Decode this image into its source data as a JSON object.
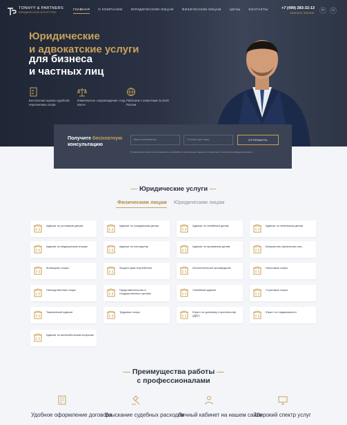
{
  "header": {
    "brand_name": "TONHYY & PARTNERS",
    "brand_tagline": "ЮРИДИЧЕСКОЕ АГЕНТСТВО",
    "nav": [
      "ГЛАВНАЯ",
      "О КОМПАНИИ",
      "ЮРИДИЧЕСКИМ ЛИЦАМ",
      "ФИЗИЧЕСКИМ ЛИЦАМ",
      "ЦЕНЫ",
      "КОНТАКТЫ"
    ],
    "phone": "+7 (499) 283-32-13",
    "callback": "ЗАКАЗАТЬ ЗВОНОК"
  },
  "hero": {
    "title_line1": "Юридические",
    "title_line2": "и адвокатские услуги",
    "title_line3": "для бизнеса",
    "title_line4": "и частных лиц",
    "features": [
      {
        "icon": "checklist-icon",
        "text": "Бесплатная оценка судебной перспективы спора"
      },
      {
        "icon": "scales-icon",
        "text": "Комплексное сопровождение «под ключ»"
      },
      {
        "icon": "globe-icon",
        "text": "Работаем с клиентами по всей России"
      }
    ]
  },
  "consult": {
    "title_a": "Получите",
    "title_b": "бесплатную",
    "title_c": "консультацию",
    "name_placeholder": "Ваше имя/фамилия",
    "phone_placeholder": "Телефон для связи",
    "submit": "ОТПРАВИТЬ",
    "note": "Оставляя ваш вопрос, вы соглашаетесь на обработку персональных данных в соответствии с политикой конфиденциальности"
  },
  "services": {
    "title": "Юридические услуги",
    "tab_active": "Физическим лицам",
    "tab_other": "Юридическим лицам",
    "items": [
      {
        "icon": "building-icon",
        "label": "Адвокат по уголовным делам"
      },
      {
        "icon": "family-icon",
        "label": "Адвокат по гражданским делам"
      },
      {
        "icon": "person-icon",
        "label": "Адвокат по семейным делам"
      },
      {
        "icon": "house-icon",
        "label": "Адвокат по земельным делам"
      },
      {
        "icon": "heart-icon",
        "label": "Адвокат по медицинским спорам"
      },
      {
        "icon": "person-icon",
        "label": "Адвокат по наследству"
      },
      {
        "icon": "worker-icon",
        "label": "Адвокат по призывным делам"
      },
      {
        "icon": "bank-icon",
        "label": "Банкротство физических лиц"
      },
      {
        "icon": "houses-icon",
        "label": "Жилищные споры"
      },
      {
        "icon": "consumer-icon",
        "label": "Защита прав потребителя"
      },
      {
        "icon": "columns-icon",
        "label": "Исполнительное производство"
      },
      {
        "icon": "tax-icon",
        "label": "Налоговые споры"
      },
      {
        "icon": "land-icon",
        "label": "Наследственные споры"
      },
      {
        "icon": "court-icon",
        "label": "Представительство в государственных органах"
      },
      {
        "icon": "family-icon",
        "label": "Семейный адвокат"
      },
      {
        "icon": "handshake-icon",
        "label": "Страховые споры"
      },
      {
        "icon": "person-icon",
        "label": "Таможенный адвокат"
      },
      {
        "icon": "briefcase-icon",
        "label": "Трудовые споры"
      },
      {
        "icon": "document-icon",
        "label": "Юрист по долевому строительству (ДДУ)"
      },
      {
        "icon": "house-icon",
        "label": "Юрист по недвижимости"
      },
      {
        "icon": "car-icon",
        "label": "Адвокат по автомобильным вопросам"
      }
    ]
  },
  "advantages": {
    "title_line1": "Преимущества работы",
    "title_line2": "с профессионалами",
    "items": [
      {
        "icon": "contract-icon",
        "label": "Удобное оформление договора"
      },
      {
        "icon": "gavel-icon",
        "label": "Взыскание судебных расходов"
      },
      {
        "icon": "account-icon",
        "label": "Личный кабинет на нашем сайте"
      },
      {
        "icon": "monitor-icon",
        "label": "Широкий спектр услуг"
      }
    ]
  },
  "colors": {
    "accent": "#c9a25b",
    "dark": "#262d3c",
    "page": "#f4f5f9"
  }
}
